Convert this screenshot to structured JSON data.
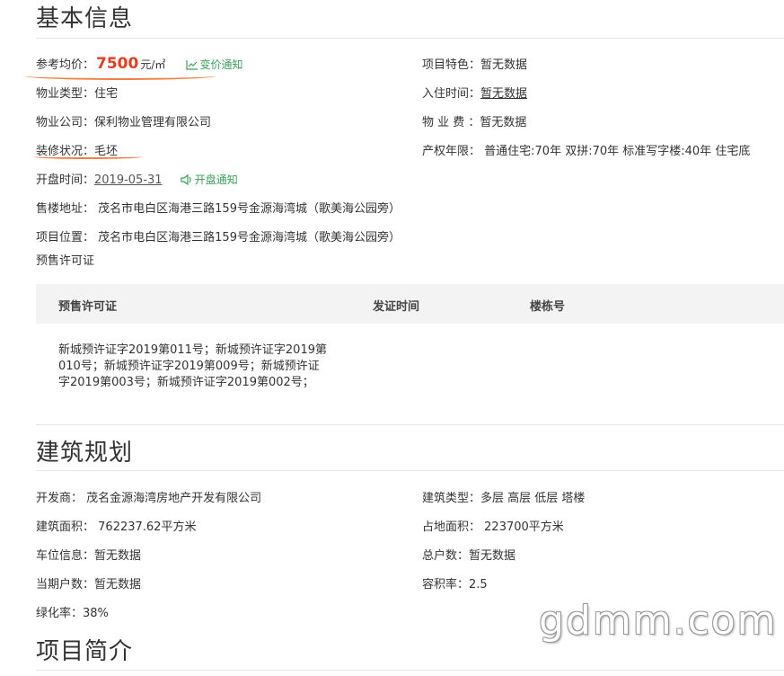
{
  "basic": {
    "title": "基本信息",
    "price_label": "参考均价：",
    "price_value": "7500",
    "price_unit": "元/㎡",
    "price_notify": "变价通知",
    "feature_label": "项目特色：",
    "feature_value": "暂无数据",
    "type_label": "物业类型：",
    "type_value": "住宅",
    "checkin_label": "入住时间：",
    "checkin_value": "暂无数据",
    "company_label": "物业公司：",
    "company_value": "保利物业管理有限公司",
    "fee_label": "物 业 费 ：",
    "fee_value": "暂无数据",
    "decor_label": "装修状况：",
    "decor_value": "毛坯",
    "rights_label": "产权年限：",
    "rights_value": "普通住宅:70年 双拼:70年 标准写字楼:40年 住宅底",
    "open_label": "开盘时间：",
    "open_value": "2019-05-31",
    "open_notify": "开盘通知",
    "sale_addr_label": "售楼地址：",
    "sale_addr_value": "茂名市电白区海港三路159号金源海湾城（歌美海公园旁）",
    "loc_label": "项目位置：",
    "loc_value": "茂名市电白区海港三路159号金源海湾城（歌美海公园旁）",
    "presale_title": "预售许可证"
  },
  "permit_table": {
    "headers": [
      "预售许可证",
      "发证时间",
      "楼栋号"
    ],
    "rows": [
      {
        "permit": "新城预许证字2019第011号；新城预许证字2019第010号；新城预许证字2019第009号；新城预许证字2019第003号；新城预许证字2019第002号；",
        "date": "",
        "building": ""
      }
    ]
  },
  "planning": {
    "title": "建筑规划",
    "dev_label": "开发商：",
    "dev_value": "茂名金源海湾房地产开发有限公司",
    "btype_label": "建筑类型：",
    "btype_value": "多层 高层 低层 塔楼",
    "barea_label": "建筑面积：",
    "barea_value": "762237.62平方米",
    "larea_label": "占地面积：",
    "larea_value": "223700平方米",
    "parking_label": "车位信息：",
    "parking_value": "暂无数据",
    "hh_label": "总户数：",
    "hh_value": "暂无数据",
    "phase_label": "当期户数：",
    "phase_value": "暂无数据",
    "far_label": "容积率：",
    "far_value": "2.5",
    "green_label": "绿化率：",
    "green_value": "38%"
  },
  "intro": {
    "title": "项目简介"
  },
  "watermark": "gdmm.com",
  "colors": {
    "price": "#e53b1e",
    "notify": "#3aa05a",
    "annotation": "#f08040"
  }
}
